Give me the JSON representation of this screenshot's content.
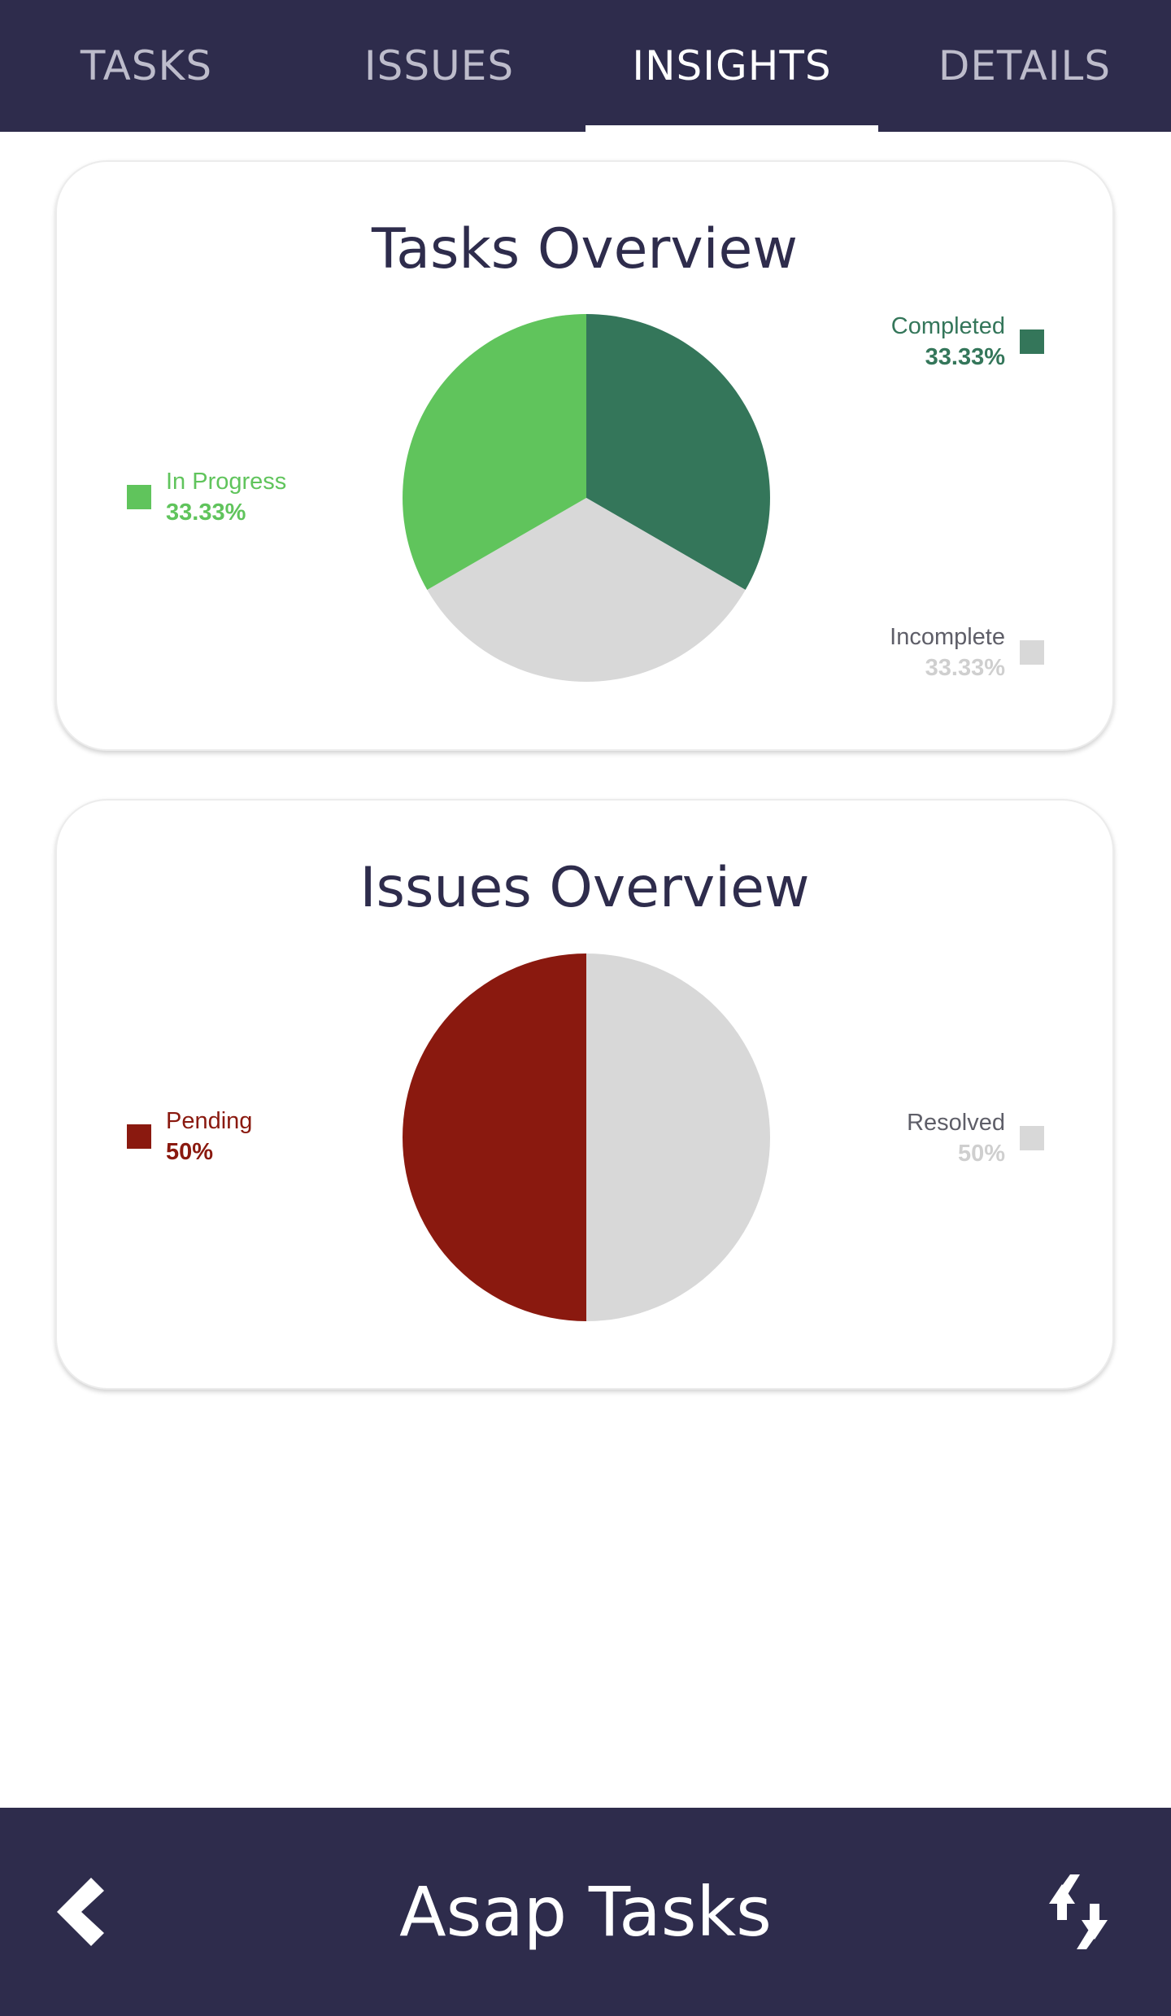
{
  "tabs": [
    {
      "label": "TASKS",
      "active": false
    },
    {
      "label": "ISSUES",
      "active": false
    },
    {
      "label": "INSIGHTS",
      "active": true
    },
    {
      "label": "DETAILS",
      "active": false
    }
  ],
  "colors": {
    "header_bg": "#2e2c4c",
    "title_text": "#2e2c4c",
    "tab_inactive": "#bdbccb",
    "tab_active": "#ffffff",
    "completed": "#34765a",
    "in_progress": "#60c45c",
    "incomplete": "#d8d8d8",
    "incomplete_label": "#5e5e68",
    "incomplete_pct": "#cfcfcf",
    "pending": "#8a190f",
    "resolved": "#d8d8d8",
    "resolved_label": "#5e5e68",
    "resolved_pct": "#cfcfcf"
  },
  "tasks_card": {
    "title": "Tasks Overview",
    "legend": {
      "completed": {
        "label": "Completed",
        "pct": "33.33%"
      },
      "in_progress": {
        "label": "In Progress",
        "pct": "33.33%"
      },
      "incomplete": {
        "label": "Incomplete",
        "pct": "33.33%"
      }
    }
  },
  "issues_card": {
    "title": "Issues Overview",
    "legend": {
      "pending": {
        "label": "Pending",
        "pct": "50%"
      },
      "resolved": {
        "label": "Resolved",
        "pct": "50%"
      }
    }
  },
  "bottom_bar": {
    "title": "Asap Tasks",
    "back_icon": "chevron-left-icon",
    "refresh_icon": "refresh-arrows-icon"
  },
  "chart_data": [
    {
      "type": "pie",
      "title": "Tasks Overview",
      "categories": [
        "Completed",
        "Incomplete",
        "In Progress"
      ],
      "values": [
        33.33,
        33.33,
        33.33
      ],
      "colors": [
        "#34765a",
        "#d8d8d8",
        "#60c45c"
      ]
    },
    {
      "type": "pie",
      "title": "Issues Overview",
      "categories": [
        "Resolved",
        "Pending"
      ],
      "values": [
        50,
        50
      ],
      "colors": [
        "#d8d8d8",
        "#8a190f"
      ]
    }
  ]
}
